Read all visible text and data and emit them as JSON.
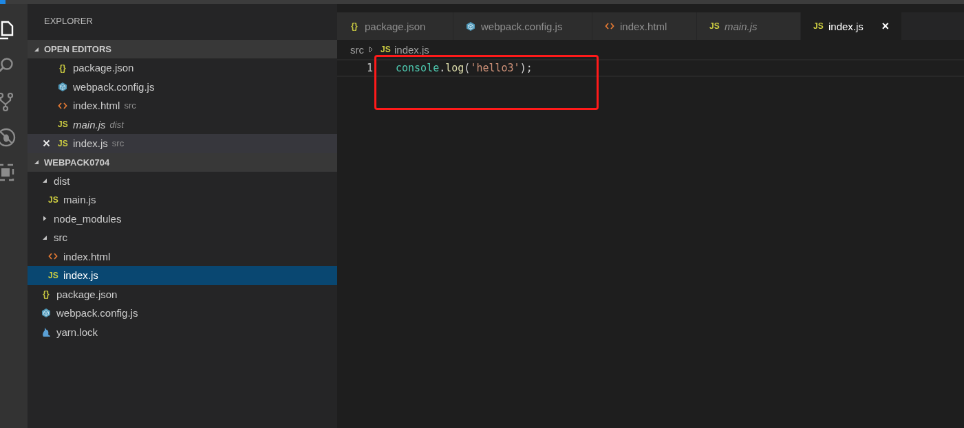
{
  "activity_bar": [
    {
      "kind": "files",
      "selected": true
    },
    {
      "kind": "search",
      "selected": false
    },
    {
      "kind": "scm",
      "selected": false
    },
    {
      "kind": "debug",
      "selected": false
    },
    {
      "kind": "extensions",
      "selected": false
    }
  ],
  "sidebar": {
    "title": "EXPLORER",
    "open_editors": {
      "title": "OPEN EDITORS",
      "expanded": true,
      "items": [
        {
          "name": "package.json",
          "kind": "json",
          "icon_text": "{}",
          "preview": false,
          "active": false
        },
        {
          "name": "webpack.config.js",
          "kind": "webpack",
          "preview": false,
          "active": false
        },
        {
          "name": "index.html",
          "kind": "html",
          "description": "src",
          "preview": false,
          "active": false
        },
        {
          "name": "main.js",
          "kind": "js",
          "icon_text": "JS",
          "description": "dist",
          "preview": true,
          "active": false
        },
        {
          "name": "index.js",
          "kind": "js",
          "icon_text": "JS",
          "description": "src",
          "preview": false,
          "active": true
        }
      ]
    },
    "folder": {
      "title": "WEBPACK0704",
      "expanded": true,
      "items": [
        {
          "name": "dist",
          "kind": "folder",
          "expanded": true,
          "selected": false,
          "children": [
            {
              "name": "main.js",
              "kind": "js",
              "icon_text": "JS",
              "selected": false
            }
          ]
        },
        {
          "name": "node_modules",
          "kind": "folder",
          "expanded": false,
          "selected": false
        },
        {
          "name": "src",
          "kind": "folder",
          "expanded": true,
          "selected": false,
          "children": [
            {
              "name": "index.html",
              "kind": "html",
              "selected": false
            },
            {
              "name": "index.js",
              "kind": "js",
              "icon_text": "JS",
              "selected": true
            }
          ]
        },
        {
          "name": "package.json",
          "kind": "json",
          "icon_text": "{}",
          "selected": false
        },
        {
          "name": "webpack.config.js",
          "kind": "webpack",
          "selected": false
        },
        {
          "name": "yarn.lock",
          "kind": "yarn",
          "selected": false
        }
      ]
    }
  },
  "tabs": [
    {
      "name": "package.json",
      "kind": "json",
      "icon_text": "{}",
      "preview": false,
      "selected": false
    },
    {
      "name": "webpack.config.js",
      "kind": "webpack",
      "preview": false,
      "selected": false
    },
    {
      "name": "index.html",
      "kind": "html",
      "preview": false,
      "selected": false
    },
    {
      "name": "main.js",
      "kind": "js",
      "icon_text": "JS",
      "preview": true,
      "selected": false
    },
    {
      "name": "index.js",
      "kind": "js",
      "icon_text": "JS",
      "preview": false,
      "selected": true,
      "close": "×"
    }
  ],
  "breadcrumb": [
    {
      "name": "src",
      "kind": "folder"
    },
    {
      "name": "index.js",
      "kind": "js",
      "icon_text": "JS"
    }
  ],
  "editor": {
    "lines": [
      {
        "number": "1",
        "tokens": [
          {
            "text": "console",
            "kind": "object"
          },
          {
            "text": ".",
            "kind": "plain"
          },
          {
            "text": "log",
            "kind": "function"
          },
          {
            "text": "(",
            "kind": "plain"
          },
          {
            "text": "'hello3'",
            "kind": "string"
          },
          {
            "text": ");",
            "kind": "plain"
          }
        ]
      }
    ],
    "highlight_box": true
  }
}
